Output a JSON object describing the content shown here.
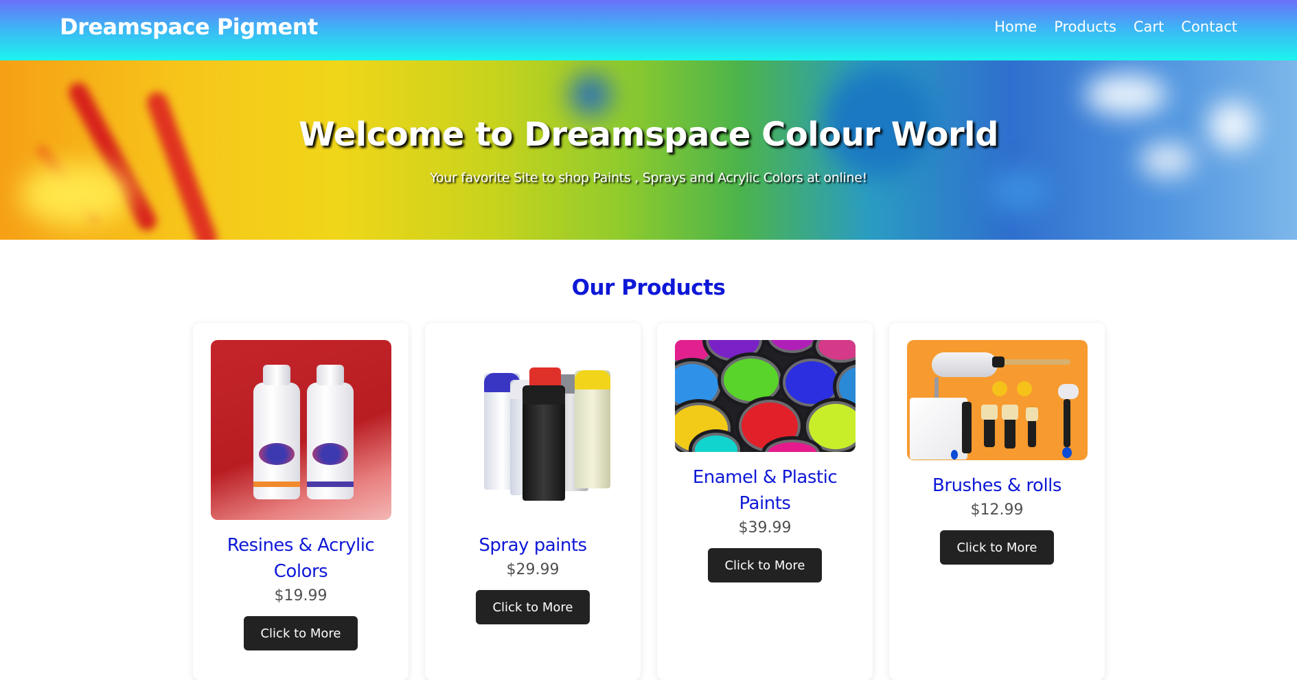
{
  "header": {
    "brand": "Dreamspace Pigment",
    "nav": [
      "Home",
      "Products",
      "Cart",
      "Contact"
    ]
  },
  "hero": {
    "title": "Welcome to Dreamspace Colour World",
    "subtitle": "Your favorite Site to shop Paints , Sprays and Acrylic Colors at online!"
  },
  "products": {
    "section_title": "Our Products",
    "items": [
      {
        "name": "Resines & Acrylic Colors",
        "price": "$19.99",
        "button": "Click to More",
        "image_icon": "resin-bottles-image"
      },
      {
        "name": "Spray paints",
        "price": "$29.99",
        "button": "Click to More",
        "image_icon": "spray-cans-image"
      },
      {
        "name": "Enamel & Plastic Paints",
        "price": "$39.99",
        "button": "Click to More",
        "image_icon": "paint-cans-image"
      },
      {
        "name": "Brushes & rolls",
        "price": "$12.99",
        "button": "Click to More",
        "image_icon": "brushes-rollers-image"
      }
    ]
  },
  "colors": {
    "header_gradient_top": "#6a70f8",
    "header_gradient_bottom": "#1cf5ee",
    "accent_blue": "#0e18d6",
    "button_bg": "#222222",
    "price_gray": "#505050"
  }
}
